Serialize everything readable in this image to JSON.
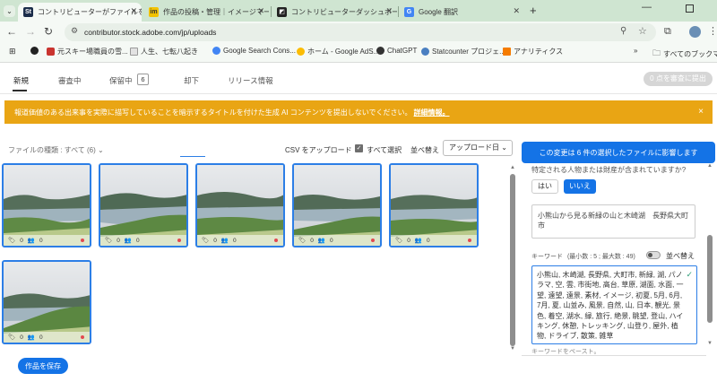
{
  "browser": {
    "tabs": [
      {
        "title": "コントリビューターがファイルをアップロ"
      },
      {
        "title": "作品の投稿・管理｜イメージマート"
      },
      {
        "title": "コントリビューターダッシュボード | Shu"
      },
      {
        "title": "Google 翻訳"
      }
    ],
    "new_tab": "+",
    "url": "contributor.stock.adobe.com/jp/uploads",
    "bookmarks": [
      "元スキー場職員の雪...",
      "人生、七転八起き",
      "Google Search Cons...",
      "ホーム - Google AdS...",
      "ChatGPT",
      "Statcounter プロジェ...",
      "アナリティクス"
    ],
    "bookmarks_folder": "すべてのブックマーク"
  },
  "nav": {
    "tabs": [
      "新規",
      "審査中",
      "保留中",
      "却下",
      "リリース情報"
    ],
    "pending_count": "6",
    "submit_button": "0 点を審査に提出"
  },
  "banner": {
    "text": "報道価値のある出来事を実際に描写していることを暗示するタイトルを付けた生成 AI コンテンツを提出しないでください。",
    "link": "詳細情報。",
    "close": "×"
  },
  "filters": {
    "file_type": "ファイルの種類 : すべて (6)",
    "csv_upload": "CSV をアップロード",
    "select_all": "すべて選択",
    "sort_label": "並べ替え",
    "sort_value": "アップロード日"
  },
  "thumbnails": [
    {
      "views": "0",
      "people": "0"
    },
    {
      "views": "0",
      "people": "0"
    },
    {
      "views": "0",
      "people": "0"
    },
    {
      "views": "0",
      "people": "0"
    },
    {
      "views": "0",
      "people": "0"
    },
    {
      "views": "0",
      "people": "0"
    }
  ],
  "save_button": "作品を保存",
  "panel": {
    "header": "この変更は 6 件の選択したファイルに影響します",
    "question": "特定される人物または財産が含まれていますか?",
    "yes": "はい",
    "no": "いいえ",
    "title_value": "小熊山から見る新緑の山と木崎湖　長野県大町市",
    "keywords_label": "キーワード",
    "keywords_hint": "(最小数 : 5 ; 最大数 : 49)",
    "sort_label": "並べ替え",
    "keywords_value": "小熊山, 木崎湖, 長野県, 大町市, 新緑, 湖, パノラマ, 空, 雲, 市街地, 高台, 草原, 湖面, 水面, 一望, 遠望, 遠景, 素材, イメージ, 初夏, 5月, 6月, 7月, 夏, 山並み, 風景, 自然, 山, 日本, 観光, 景色, 着空, 湖水, 緑, 旅行, 絶景, 眺望, 登山, ハイキング, 休憩, トレッキング, 山登り, 屋外, 植物, ドライブ, 散策, 雑草",
    "paste_hint": "キーワードをペースト。"
  },
  "colors": {
    "accent": "#1473e6",
    "banner": "#e9a514",
    "tabstrip": "#cfe5d1",
    "error_dot": "#e34850"
  }
}
